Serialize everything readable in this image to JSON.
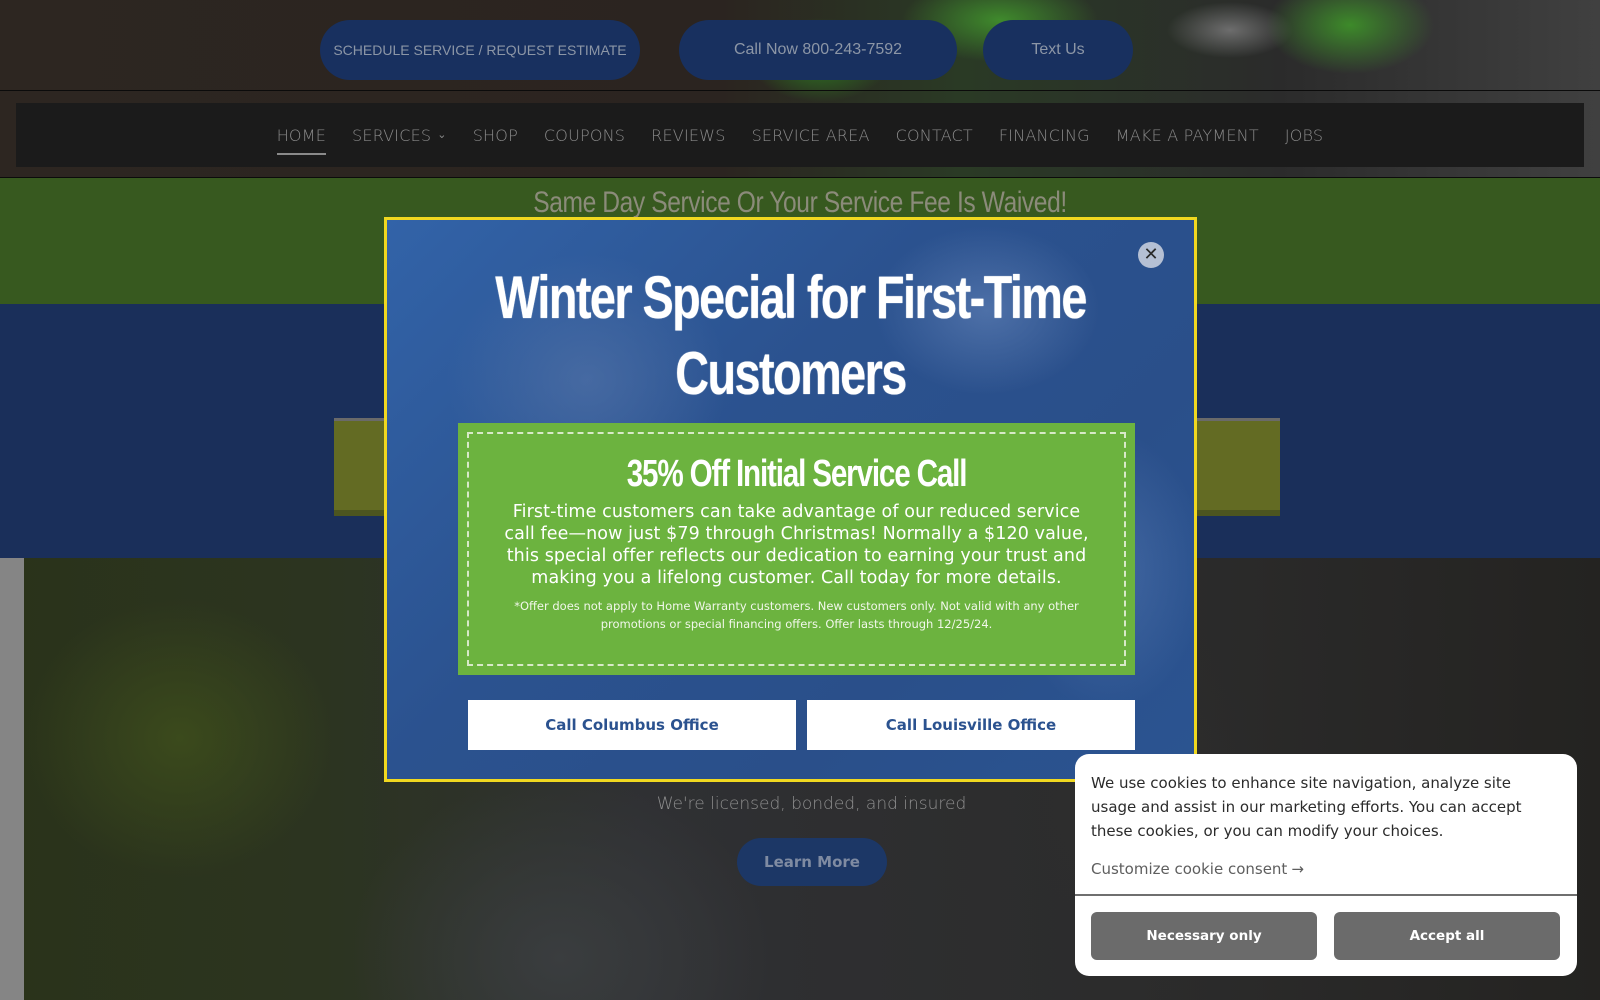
{
  "header": {
    "cta_buttons": {
      "schedule": "SCHEDULE SERVICE / REQUEST ESTIMATE",
      "call": "Call Now 800-243-7592",
      "text": "Text Us"
    },
    "nav": {
      "items": [
        {
          "label": "HOME",
          "active": true
        },
        {
          "label": "SERVICES",
          "has_dropdown": true,
          "dropdown_icon": "chevron-down-icon"
        },
        {
          "label": "SHOP"
        },
        {
          "label": "COUPONS"
        },
        {
          "label": "REVIEWS"
        },
        {
          "label": "SERVICE AREA"
        },
        {
          "label": "CONTACT"
        },
        {
          "label": "FINANCING"
        },
        {
          "label": "MAKE A PAYMENT"
        },
        {
          "label": "JOBS"
        }
      ],
      "chevron_glyph": "⌄"
    }
  },
  "banner": {
    "tagline": "Same Day Service Or Your Service Fee Is Waived!"
  },
  "hero": {
    "subtitle": "We're licensed, bonded, and insured",
    "learn_more": "Learn More"
  },
  "popup": {
    "title": "Winter Special for First-Time Customers",
    "close_glyph": "✕",
    "coupon": {
      "headline": "35% Off Initial Service Call",
      "body": "First-time customers can take advantage of our reduced service call fee—now just $79 through Christmas! Normally a $120 value, this special offer reflects our dedication to earning your trust and making you a lifelong customer. Call today for more details.",
      "fine_print": "*Offer does not apply to Home Warranty customers. New customers only. Not valid with any other promotions or special financing offers. Offer lasts through 12/25/24."
    },
    "buttons": {
      "columbus": "Call Columbus Office",
      "louisville": "Call Louisville Office"
    }
  },
  "cookie_banner": {
    "message": "We use cookies to enhance site navigation, analyze site usage and assist in our marketing efforts. You can accept these cookies, or you can modify your choices.",
    "customize_link": "Customize cookie consent",
    "arrow_glyph": "→",
    "necessary_only": "Necessary only",
    "accept_all": "Accept all"
  },
  "colors": {
    "brand_blue": "#2b528f",
    "brand_green": "#6cb33f",
    "popup_border_yellow": "#f0d820",
    "cookie_button_gray": "#6b6b6b"
  }
}
